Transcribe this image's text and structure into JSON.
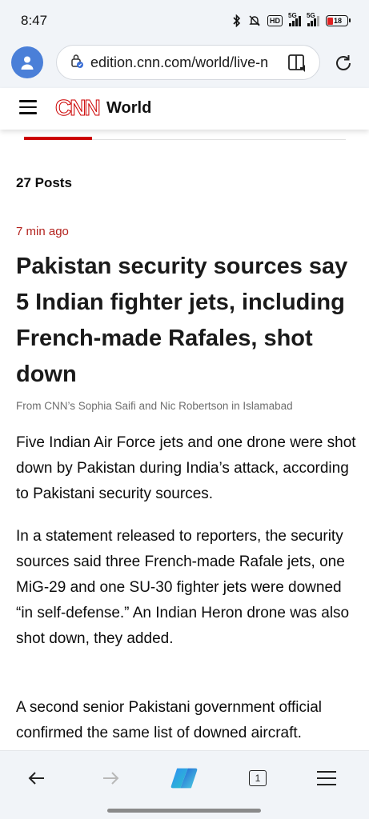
{
  "status_bar": {
    "time": "8:47",
    "hd_label": "HD",
    "network_1": "5G",
    "network_2": "5G",
    "battery": "18"
  },
  "browser": {
    "url": "edition.cnn.com/world/live-n",
    "icons": [
      "profile-icon",
      "site-info-icon",
      "reader-mode-icon",
      "reload-icon"
    ]
  },
  "site_header": {
    "logo": "CNN",
    "section": "World"
  },
  "feed": {
    "posts_count": "27 Posts"
  },
  "post": {
    "time_ago": "7 min ago",
    "headline": "Pakistan security sources say 5 Indian fighter jets, including French-made Rafales, shot down",
    "byline": "From CNN’s Sophia Saifi and Nic Robertson in Islamabad",
    "paragraphs": [
      "Five Indian Air Force jets and one drone were shot down by Pakistan during India’s attack, according to Pakistani security sources.",
      "In a statement released to reporters, the security sources said three French-made Rafale jets, one MiG-29 and one SU-30 fighter jets were downed “in self-defense.” An Indian Heron drone was also shot down, they added.",
      "A second senior Pakistani government official confirmed the same list of downed aircraft."
    ]
  },
  "bottom_nav": {
    "tab_count": "1",
    "icons": [
      "back-icon",
      "forward-icon",
      "copilot-icon",
      "tabs-icon",
      "menu-icon"
    ],
    "accent": "#cc0000"
  }
}
